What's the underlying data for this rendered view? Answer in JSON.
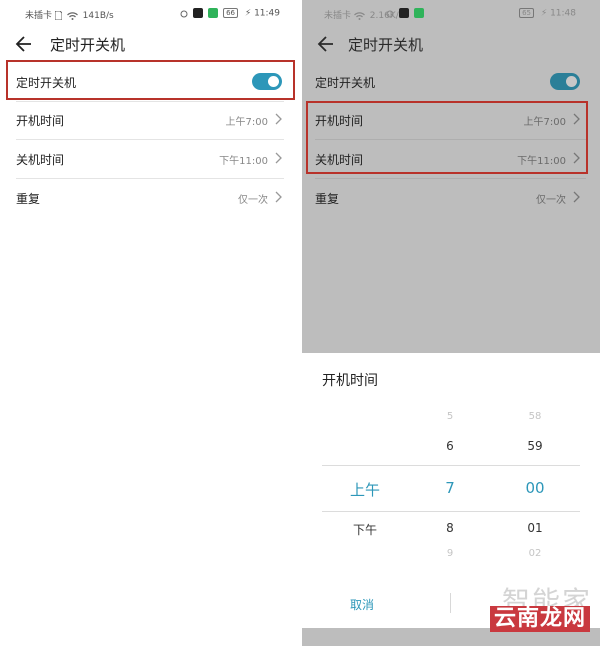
{
  "left": {
    "status": {
      "carrier": "未插卡",
      "speed": "141B/s",
      "battery": "66",
      "time": "11:49"
    },
    "header": {
      "title": "定时开关机"
    },
    "rows": [
      {
        "label": "定时开关机",
        "toggle_on": true
      },
      {
        "label": "开机时间",
        "value": "上午7:00"
      },
      {
        "label": "关机时间",
        "value": "下午11:00"
      },
      {
        "label": "重复",
        "value": "仅一次"
      }
    ]
  },
  "right": {
    "status": {
      "carrier": "未插卡",
      "speed": "2.16K/s",
      "battery": "65",
      "time": "11:48"
    },
    "header": {
      "title": "定时开关机"
    },
    "rows": [
      {
        "label": "定时开关机",
        "toggle_on": true
      },
      {
        "label": "开机时间",
        "value": "上午7:00"
      },
      {
        "label": "关机时间",
        "value": "下午11:00"
      },
      {
        "label": "重复",
        "value": "仅一次"
      }
    ],
    "sheet": {
      "title": "开机时间",
      "picker": {
        "row_far_top": {
          "ampm": "",
          "hour": "5",
          "minute": "58"
        },
        "row_near_top": {
          "ampm": "",
          "hour": "6",
          "minute": "59"
        },
        "row_selected": {
          "ampm": "上午",
          "hour": "7",
          "minute": "00"
        },
        "row_near_bottom": {
          "ampm": "下午",
          "hour": "8",
          "minute": "01"
        },
        "row_far_bottom": {
          "ampm": "",
          "hour": "9",
          "minute": "02"
        }
      },
      "cancel_label": "取消",
      "confirm_label": ""
    }
  },
  "watermark": {
    "line1": "智能家",
    "line2": "云南龙网"
  },
  "colors": {
    "accent": "#2d97b9",
    "highlight_border": "#b8322a",
    "overlay": "#bdbdbd"
  }
}
